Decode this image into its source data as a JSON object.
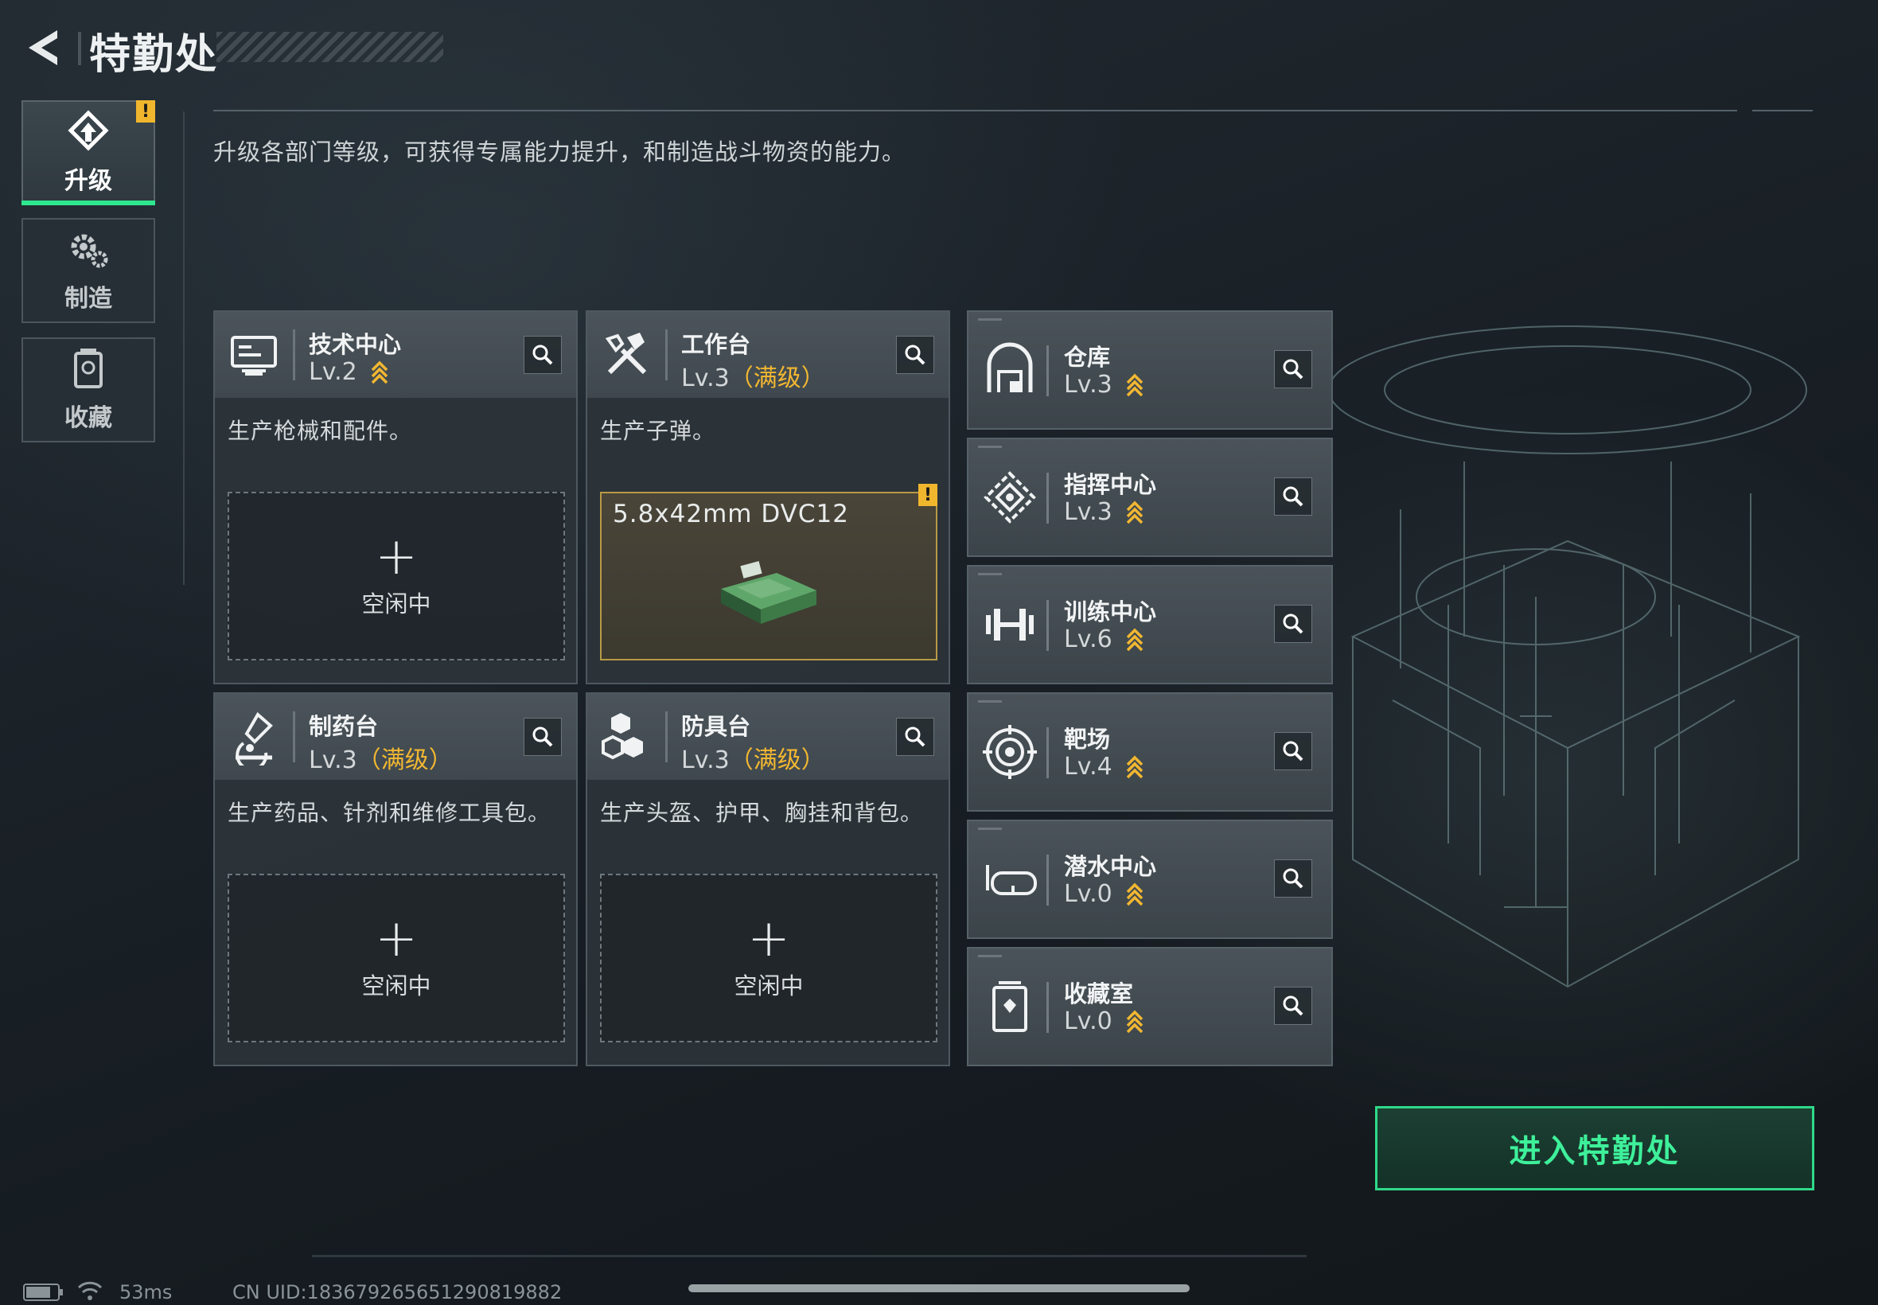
{
  "header": {
    "title": "特勤处"
  },
  "sidebar": {
    "items": [
      {
        "label": "升级",
        "icon": "upgrade-icon",
        "active": true,
        "alert": "!"
      },
      {
        "label": "制造",
        "icon": "gears-icon",
        "active": false
      },
      {
        "label": "收藏",
        "icon": "collection-icon",
        "active": false
      }
    ]
  },
  "description": "升级各部门等级，可获得专属能力提升，和制造战斗物资的能力。",
  "cards": [
    {
      "name": "技术中心",
      "level": "Lv.2",
      "max_tag": "",
      "desc": "生产枪械和配件。",
      "slot_plus": "+",
      "slot_status": "空闲中",
      "icon": "tech-center-icon"
    },
    {
      "name": "工作台",
      "level": "Lv.3",
      "max_tag": "（满级）",
      "desc": "生产子弹。",
      "item": "5.8x42mm DVC12",
      "alert": "!",
      "icon": "workbench-icon"
    },
    {
      "name": "制药台",
      "level": "Lv.3",
      "max_tag": "（满级）",
      "desc": "生产药品、针剂和维修工具包。",
      "slot_plus": "+",
      "slot_status": "空闲中",
      "icon": "pharmacy-icon"
    },
    {
      "name": "防具台",
      "level": "Lv.3",
      "max_tag": "（满级）",
      "desc": "生产头盔、护甲、胸挂和背包。",
      "slot_plus": "+",
      "slot_status": "空闲中",
      "icon": "armor-bench-icon"
    }
  ],
  "facilities": [
    {
      "name": "仓库",
      "level": "Lv.3",
      "icon": "warehouse-icon"
    },
    {
      "name": "指挥中心",
      "level": "Lv.3",
      "icon": "command-center-icon"
    },
    {
      "name": "训练中心",
      "level": "Lv.6",
      "icon": "dumbbell-icon"
    },
    {
      "name": "靶场",
      "level": "Lv.4",
      "icon": "target-icon"
    },
    {
      "name": "潜水中心",
      "level": "Lv.0",
      "icon": "dive-mask-icon"
    },
    {
      "name": "收藏室",
      "level": "Lv.0",
      "icon": "collection-room-icon"
    }
  ],
  "enter_button": "进入特勤处",
  "status": {
    "ping": "53ms",
    "uid": "CN UID:18367926565129081988​2"
  },
  "colors": {
    "accent": "#2ee88f",
    "level_arrow": "#f2b731",
    "alert": "#f0b62d"
  }
}
